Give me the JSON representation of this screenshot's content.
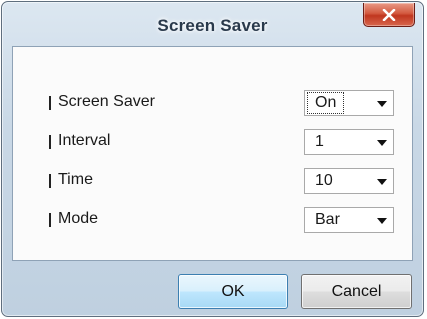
{
  "window": {
    "title": "Screen Saver",
    "close_icon": "close-x-icon"
  },
  "settings": [
    {
      "label": "Screen Saver",
      "value": "On",
      "focused": true
    },
    {
      "label": "Interval",
      "value": "1",
      "focused": false
    },
    {
      "label": "Time",
      "value": "10",
      "focused": false
    },
    {
      "label": "Mode",
      "value": "Bar",
      "focused": false
    }
  ],
  "buttons": {
    "ok_label": "OK",
    "cancel_label": "Cancel"
  },
  "colors": {
    "close_button": "#c8432b",
    "frame": "#c9d8e6",
    "default_button": "#bee6fd"
  }
}
